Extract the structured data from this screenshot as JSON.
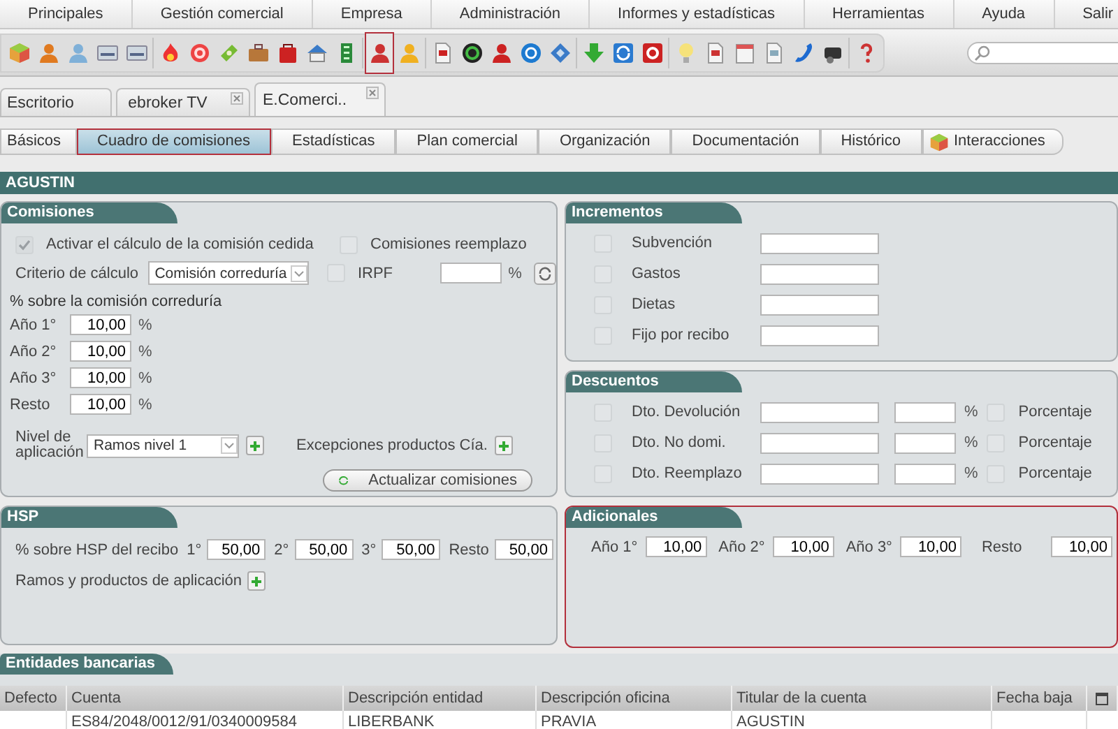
{
  "menu": [
    "Principales",
    "Gestión comercial",
    "Empresa",
    "Administración",
    "Informes y estadísticas",
    "Herramientas",
    "Ayuda",
    "Salir"
  ],
  "toolbar": [
    {
      "selected": false
    },
    {
      "selected": false
    },
    {
      "selected": false
    },
    {
      "selected": false
    },
    {
      "selected": false
    },
    {
      "selected": false
    },
    {
      "selected": false
    },
    {
      "selected": false
    },
    {
      "selected": false
    },
    {
      "selected": false
    },
    {
      "selected": false
    },
    {
      "selected": false
    },
    {
      "selected": true
    },
    {
      "selected": false
    },
    {
      "selected": false
    },
    {
      "selected": false
    },
    {
      "selected": false
    },
    {
      "selected": false
    },
    {
      "selected": false
    },
    {
      "selected": false
    },
    {
      "selected": false
    },
    {
      "selected": false
    },
    {
      "selected": false
    },
    {
      "selected": false
    },
    {
      "selected": false
    },
    {
      "selected": false
    },
    {
      "selected": false
    },
    {
      "selected": false
    },
    {
      "selected": false
    }
  ],
  "doc_tabs": [
    {
      "label": "Escritorio",
      "selected": false,
      "closable": false
    },
    {
      "label": "ebroker TV",
      "selected": false,
      "closable": true
    },
    {
      "label": "E.Comerci..",
      "selected": true,
      "closable": true
    }
  ],
  "sub_tabs": [
    {
      "label": "Básicos",
      "selected": false,
      "has_icon": false
    },
    {
      "label": "Cuadro de comisiones",
      "selected": true,
      "has_icon": false
    },
    {
      "label": "Estadísticas",
      "selected": false,
      "has_icon": false
    },
    {
      "label": "Plan comercial",
      "selected": false,
      "has_icon": false
    },
    {
      "label": "Organización",
      "selected": false,
      "has_icon": false
    },
    {
      "label": "Documentación",
      "selected": false,
      "has_icon": false
    },
    {
      "label": "Histórico",
      "selected": false,
      "has_icon": false
    },
    {
      "label": "Interacciones",
      "selected": false,
      "has_icon": true
    }
  ],
  "record_title": "AGUSTIN",
  "comisiones": {
    "title": "Comisiones",
    "activar": {
      "label": "Activar el cálculo de la comisión cedida",
      "checked": true
    },
    "reemplazo": {
      "label": "Comisiones reemplazo",
      "checked": false
    },
    "criterio": {
      "label": "Criterio de cálculo",
      "value": "Comisión correduría"
    },
    "irpf": {
      "label": "IRPF",
      "checked": false,
      "unit": "%"
    },
    "subtitle": "% sobre la comisión correduría",
    "years": [
      {
        "label": "Año 1°",
        "value": "10,00",
        "unit": "%"
      },
      {
        "label": "Año 2°",
        "value": "10,00",
        "unit": "%"
      },
      {
        "label": "Año 3°",
        "value": "10,00",
        "unit": "%"
      },
      {
        "label": "Resto",
        "value": "10,00",
        "unit": "%"
      }
    ],
    "nivel": {
      "label": "Nivel de aplicación",
      "value": "Ramos nivel 1"
    },
    "excepciones": "Excepciones productos Cía.",
    "update_button": "Actualizar comisiones"
  },
  "incrementos": {
    "title": "Incrementos",
    "rows": [
      {
        "label": "Subvención",
        "checked": false
      },
      {
        "label": "Gastos",
        "checked": false
      },
      {
        "label": "Dietas",
        "checked": false
      },
      {
        "label": "Fijo por recibo",
        "checked": false
      }
    ]
  },
  "descuentos": {
    "title": "Descuentos",
    "rows": [
      {
        "label": "Dto. Devolución",
        "checked": false,
        "unit": "%",
        "pct_label": "Porcentaje",
        "pct_checked": false
      },
      {
        "label": "Dto. No domi.",
        "checked": false,
        "unit": "%",
        "pct_label": "Porcentaje",
        "pct_checked": false
      },
      {
        "label": "Dto. Reemplazo",
        "checked": false,
        "unit": "%",
        "pct_label": "Porcentaje",
        "pct_checked": false
      }
    ]
  },
  "hsp": {
    "title": "HSP",
    "label": "% sobre HSP del recibo",
    "fields": [
      {
        "label": "1°",
        "value": "50,00"
      },
      {
        "label": "2°",
        "value": "50,00"
      },
      {
        "label": "3°",
        "value": "50,00"
      },
      {
        "label": "Resto",
        "value": "50,00"
      }
    ],
    "ramos": "Ramos y productos de aplicación"
  },
  "adicionales": {
    "title": "Adicionales",
    "highlighted": true,
    "fields": [
      {
        "label": "Año 1°",
        "value": "10,00"
      },
      {
        "label": "Año 2°",
        "value": "10,00"
      },
      {
        "label": "Año 3°",
        "value": "10,00"
      },
      {
        "label": "Resto",
        "value": "10,00"
      }
    ]
  },
  "bancos": {
    "title": "Entidades bancarias",
    "columns": [
      "Defecto",
      "Cuenta",
      "Descripción entidad",
      "Descripción oficina",
      "Titular de la cuenta",
      "Fecha baja"
    ],
    "rows": [
      {
        "cuenta": "ES84/2048/0012/91/0340009584",
        "entidad": "LIBERBANK",
        "oficina": "PRAVIA",
        "titular": "AGUSTIN"
      }
    ]
  }
}
